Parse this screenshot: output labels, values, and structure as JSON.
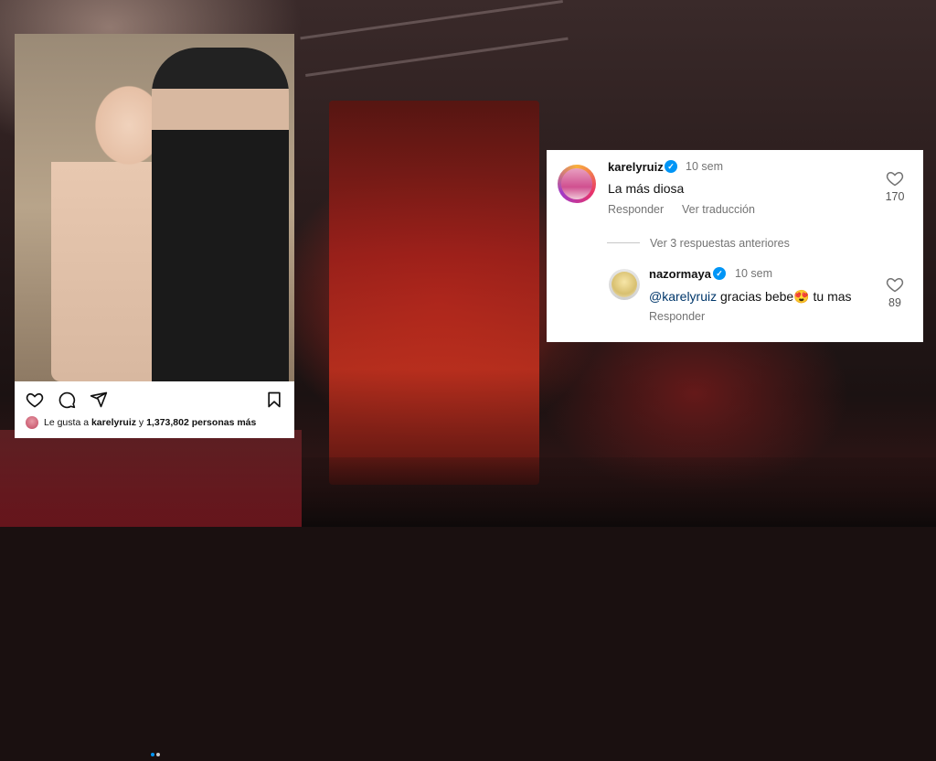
{
  "post": {
    "likes_prefix": "Le gusta a",
    "likes_user": "karelyruiz",
    "likes_joiner": "y",
    "likes_count": "1,373,802 personas más",
    "carousel_dots": 2,
    "carousel_active": 0,
    "accent_color": "#0095f6"
  },
  "comments": {
    "comment1": {
      "username": "karelyruiz",
      "time": "10 sem",
      "text": "La más diosa",
      "reply_label": "Responder",
      "translate_label": "Ver traducción",
      "likes": "170"
    },
    "view_replies": "Ver 3 respuestas anteriores",
    "reply1": {
      "username": "nazormaya",
      "time": "10 sem",
      "mention": "@karelyruiz",
      "text_a": "gracias bebe",
      "emoji": "😍",
      "text_b": "tu mas",
      "reply_label": "Responder",
      "likes": "89"
    },
    "verified_color": "#0095f6"
  },
  "icons": [
    "heart-icon",
    "comment-icon",
    "share-icon",
    "bookmark-icon",
    "verified-icon"
  ]
}
